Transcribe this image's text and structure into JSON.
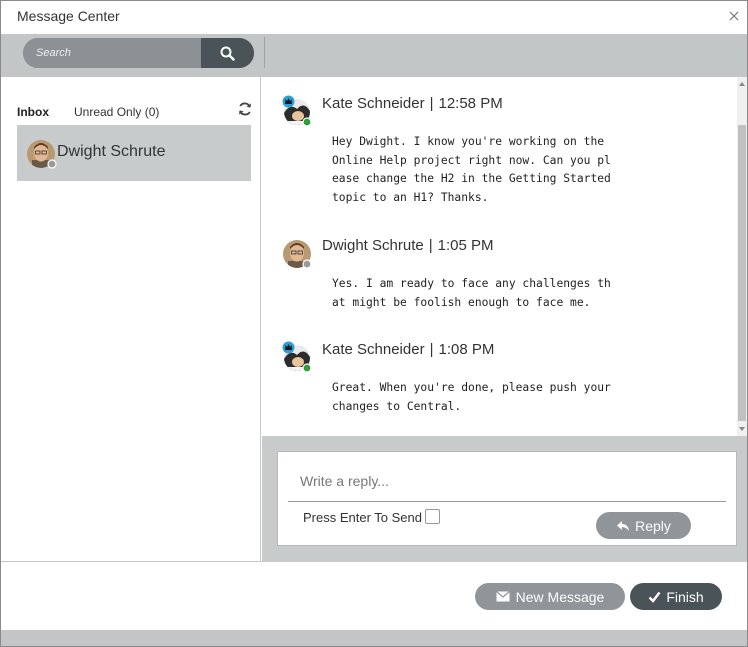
{
  "window": {
    "title": "Message Center"
  },
  "search": {
    "placeholder": "Search"
  },
  "inbox": {
    "tab_inbox": "Inbox",
    "tab_unread": "Unread Only (0)",
    "conversations": [
      {
        "name": "Dwight Schrute"
      }
    ]
  },
  "messages": [
    {
      "sender": "Kate Schneider",
      "separator": "|",
      "time": "12:58 PM",
      "status": "online",
      "body": "Hey Dwight. I know you're working on the\nOnline Help project right now. Can you pl\nease change the H2 in the Getting Started\ntopic to an H1? Thanks."
    },
    {
      "sender": "Dwight Schrute",
      "separator": "|",
      "time": "1:05 PM",
      "status": "offline",
      "body": "Yes. I am ready to face any challenges th\nat might be foolish enough to face me."
    },
    {
      "sender": "Kate Schneider",
      "separator": "|",
      "time": "1:08 PM",
      "status": "online",
      "body": "Great. When you're done, please push your\nchanges to Central."
    }
  ],
  "reply": {
    "placeholder": "Write a reply...",
    "press_enter_label": "Press Enter To Send",
    "press_enter_checked": false,
    "reply_label": "Reply"
  },
  "footer": {
    "new_message_label": "New Message",
    "finish_label": "Finish"
  },
  "colors": {
    "accent_dark": "#4a5357",
    "button_gray": "#8f9598",
    "toolbar_gray": "#c2c6c7",
    "online_green": "#2e9e3a",
    "offline_gray": "#9a9a9a",
    "crown_blue": "#2a9fd8"
  }
}
